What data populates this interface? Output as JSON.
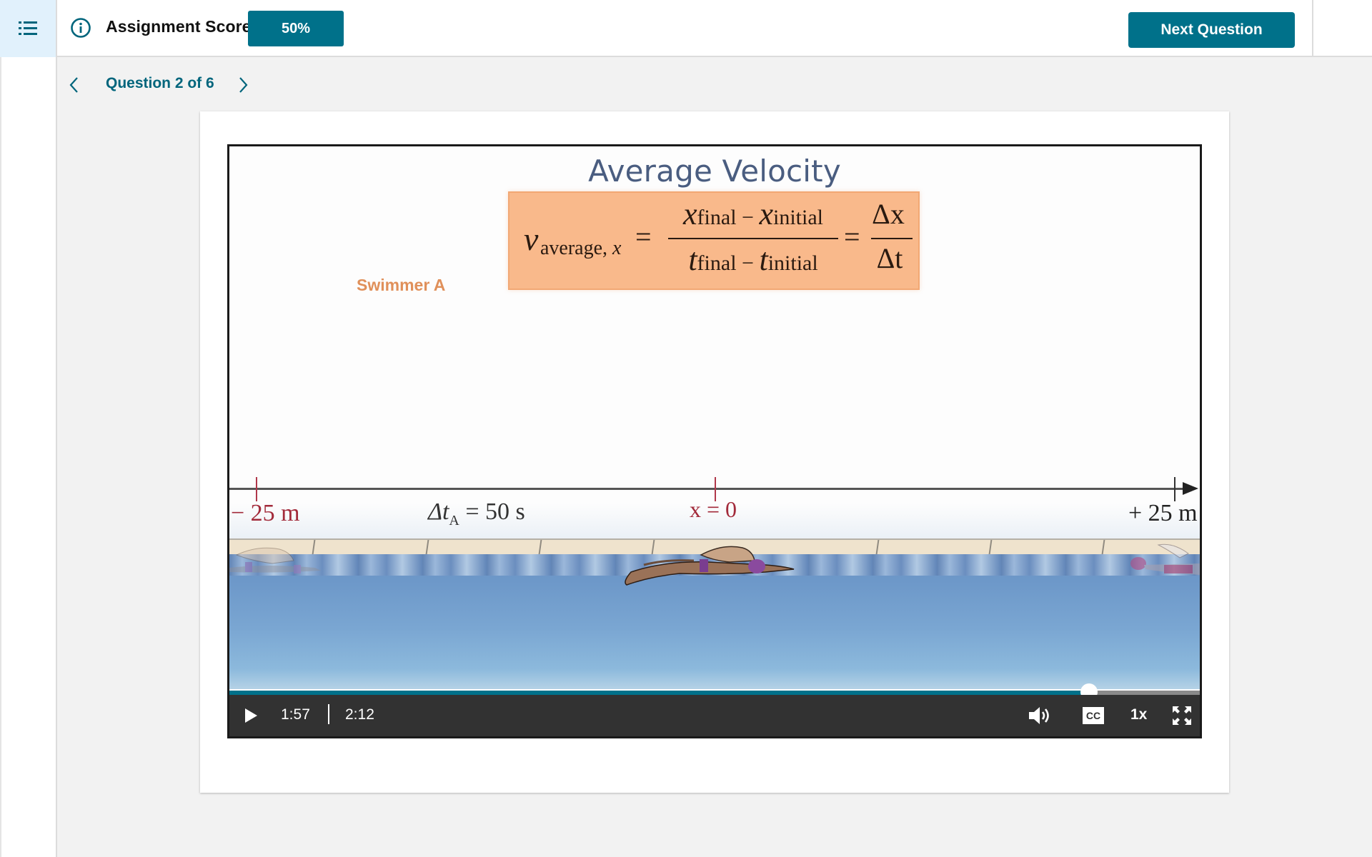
{
  "header": {
    "menu_icon": "list-icon",
    "info_icon": "info-circle-icon",
    "score_label": "Assignment Score:",
    "score_value": "50%",
    "next_button": "Next Question"
  },
  "question_nav": {
    "prev_icon": "chevron-left-icon",
    "label": "Question 2 of 6",
    "next_icon": "chevron-right-icon",
    "current": 2,
    "total": 6
  },
  "video": {
    "title": "Average Velocity",
    "formula": {
      "lhs_symbol": "v",
      "lhs_subscript": "average,",
      "lhs_subscript_var": "x",
      "equals": "=",
      "numerator_a": "x",
      "numerator_a_sub": "final",
      "minus": "−",
      "numerator_b": "x",
      "numerator_b_sub": "initial",
      "denominator_a": "t",
      "denominator_a_sub": "final",
      "denominator_b": "t",
      "denominator_b_sub": "initial",
      "delta_num": "Δx",
      "delta_den": "Δt"
    },
    "swimmer_label": "Swimmer A",
    "axis_labels": {
      "negative": "− 25 m",
      "delta_t_prefix": "Δt",
      "delta_t_sub": "A",
      "delta_t_value": " = 50 s",
      "zero": "x = 0",
      "positive": "+ 25 m"
    },
    "controls": {
      "play_icon": "play-icon",
      "current_time": "1:57",
      "duration": "2:12",
      "progress_fraction": 0.886,
      "volume_icon": "volume-icon",
      "cc_label": "CC",
      "speed_label": "1x",
      "fullscreen_icon": "fullscreen-icon"
    },
    "colors": {
      "accent": "#00718a",
      "formula_bg": "#f9b98b",
      "swimmer_label": "#e0905a",
      "axis_red": "#a22a3a"
    }
  }
}
